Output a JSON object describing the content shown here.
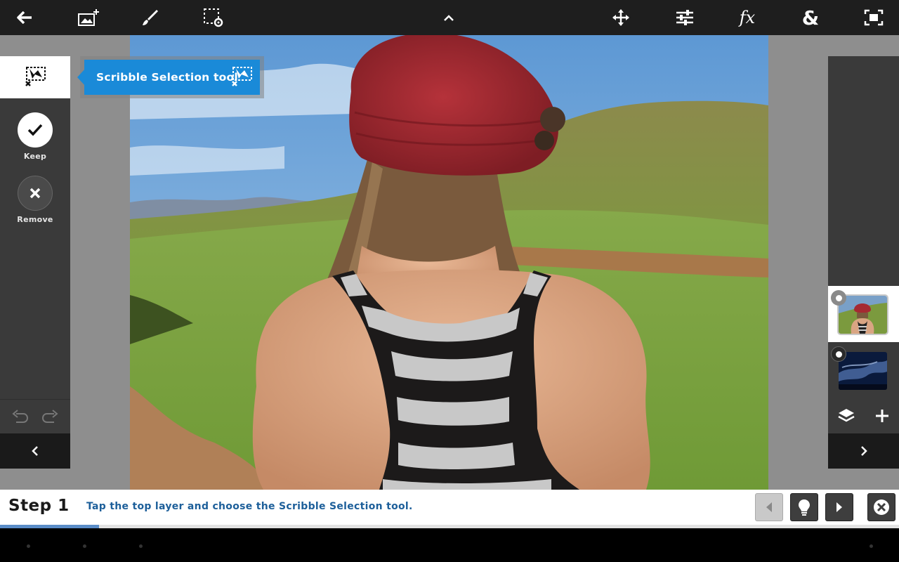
{
  "toolbar": {
    "items": [
      "back",
      "add-image",
      "brush",
      "selection-settings",
      "collapse",
      "move",
      "adjustments",
      "fx",
      "ampersand",
      "fit-screen"
    ],
    "fx_label": "fx",
    "amp_label": "&"
  },
  "left_panel": {
    "active_tool_icon": "scribble-selection-icon",
    "keep_label": "Keep",
    "remove_label": "Remove"
  },
  "tooltip": {
    "text": "Scribble Selection tool"
  },
  "right_panel": {
    "layers": [
      {
        "name": "woman-hat-photo",
        "selected": true
      },
      {
        "name": "night-sky-photo",
        "selected": false
      }
    ]
  },
  "step": {
    "title": "Step 1",
    "instruction": "Tap the top layer and choose the Scribble Selection tool.",
    "progress_fraction": 0.11
  },
  "colors": {
    "toolbar_bg": "#1e1e1e",
    "panel_bg": "#3a3a3a",
    "accent": "#1a8ad8",
    "step_text": "#1d5f9a",
    "progress": "#5a8cc7"
  }
}
